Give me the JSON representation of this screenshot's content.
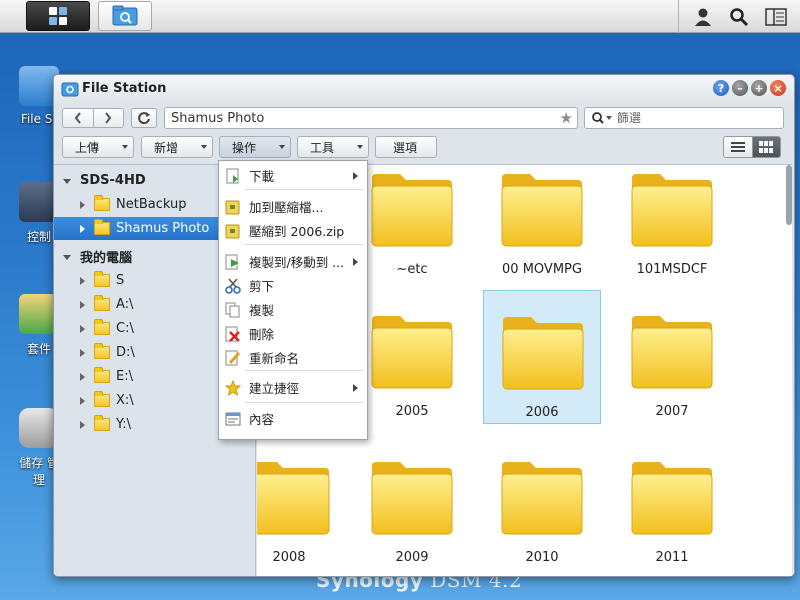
{
  "taskbar": {
    "main_menu_icon": "grid-icon",
    "app_icon": "file-station-icon",
    "user_icon": "user-icon",
    "search_icon": "search-icon",
    "widgets_icon": "widgets-icon"
  },
  "desktop": {
    "icons": [
      {
        "label": "File St",
        "icon": "file-station-icon"
      },
      {
        "label": "控制",
        "icon": "control-panel-icon"
      },
      {
        "label": "套件",
        "icon": "package-icon"
      },
      {
        "label": "儲存 管理",
        "icon": "storage-icon"
      }
    ],
    "footer_brand": "Synology",
    "footer_product": "DSM 4.2"
  },
  "window": {
    "title": "File Station",
    "path": "Shamus Photo",
    "search_placeholder": "篩選",
    "toolbar": {
      "upload": "上傳",
      "create": "新增",
      "action": "操作",
      "tools": "工具",
      "options": "選項"
    }
  },
  "sidebar": {
    "root1": "SDS-4HD",
    "root1_items": [
      "NetBackup",
      "Shamus Photo"
    ],
    "root2": "我的電腦",
    "root2_items": [
      "S",
      "A:\\",
      "C:\\",
      "D:\\",
      "E:\\",
      "X:\\",
      "Y:\\"
    ]
  },
  "folders": [
    "~etc",
    "00 MOVMPG",
    "101MSDCF",
    "2005",
    "2006",
    "2007",
    "2008",
    "2009",
    "2010",
    "2011"
  ],
  "selected_folder": "2006",
  "context_menu": [
    {
      "label": "下載",
      "icon": "download-icon"
    },
    {
      "label": "加到壓縮檔...",
      "icon": "archive-icon"
    },
    {
      "label": "壓縮到 2006.zip",
      "icon": "zip-icon"
    },
    {
      "label": "複製到/移動到 ...",
      "icon": "copy-move-icon"
    },
    {
      "label": "剪下",
      "icon": "cut-icon"
    },
    {
      "label": "複製",
      "icon": "copy-icon"
    },
    {
      "label": "刪除",
      "icon": "delete-icon"
    },
    {
      "label": "重新命名",
      "icon": "rename-icon"
    },
    {
      "label": "建立捷徑",
      "icon": "star-icon"
    },
    {
      "label": "內容",
      "icon": "properties-icon"
    }
  ],
  "colors": {
    "selection": "#2574cb",
    "folder": "#f4c623",
    "tile_selected": "#d3ebf8"
  }
}
